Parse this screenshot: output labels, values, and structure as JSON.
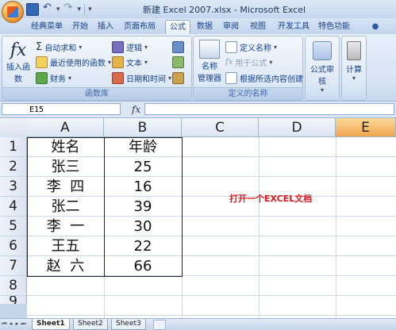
{
  "window": {
    "title": "新建 Excel 2007.xlsx - Microsoft Excel"
  },
  "ribbon": {
    "tabs": [
      "经典菜单",
      "开始",
      "插入",
      "页面布局",
      "公式",
      "数据",
      "审阅",
      "视图",
      "开发工具",
      "特色功能"
    ],
    "active_tab": "公式",
    "function_library": {
      "insert_function": "插入函数",
      "autosum": "自动求和",
      "recent": "最近使用的函数",
      "financial": "财务",
      "logical": "逻辑",
      "text": "文本",
      "datetime": "日期和时间",
      "label": "函数库"
    },
    "defined_names": {
      "name_manager_line1": "名称",
      "name_manager_line2": "管理器",
      "define_name": "定义名称",
      "use_in_formula": "用于公式",
      "create_from_selection": "根据所选内容创建",
      "label": "定义的名称"
    },
    "auditing": {
      "label": "公式审核"
    },
    "calculation": {
      "label": "计算"
    }
  },
  "formula_bar": {
    "name_box": "E15",
    "fx": "fx",
    "value": ""
  },
  "columns": [
    "A",
    "B",
    "C",
    "D",
    "E"
  ],
  "selected_column": "E",
  "rows": [
    "1",
    "2",
    "3",
    "4",
    "5",
    "6",
    "7",
    "8",
    "9"
  ],
  "table": {
    "header": [
      "姓名",
      "年龄"
    ],
    "rows": [
      [
        "张三",
        "25"
      ],
      [
        "李  四",
        "16"
      ],
      [
        "张二",
        "39"
      ],
      [
        "李  一",
        "30"
      ],
      [
        "王五",
        "22"
      ],
      [
        "赵  六",
        "66"
      ]
    ]
  },
  "note": "打开一个EXCEL文档",
  "colors": {
    "note": "#e0161b",
    "selected_header": "#f1a54d"
  },
  "sheet_tabs": [
    "Sheet1",
    "Sheet2",
    "Sheet3"
  ],
  "active_sheet": "Sheet1"
}
